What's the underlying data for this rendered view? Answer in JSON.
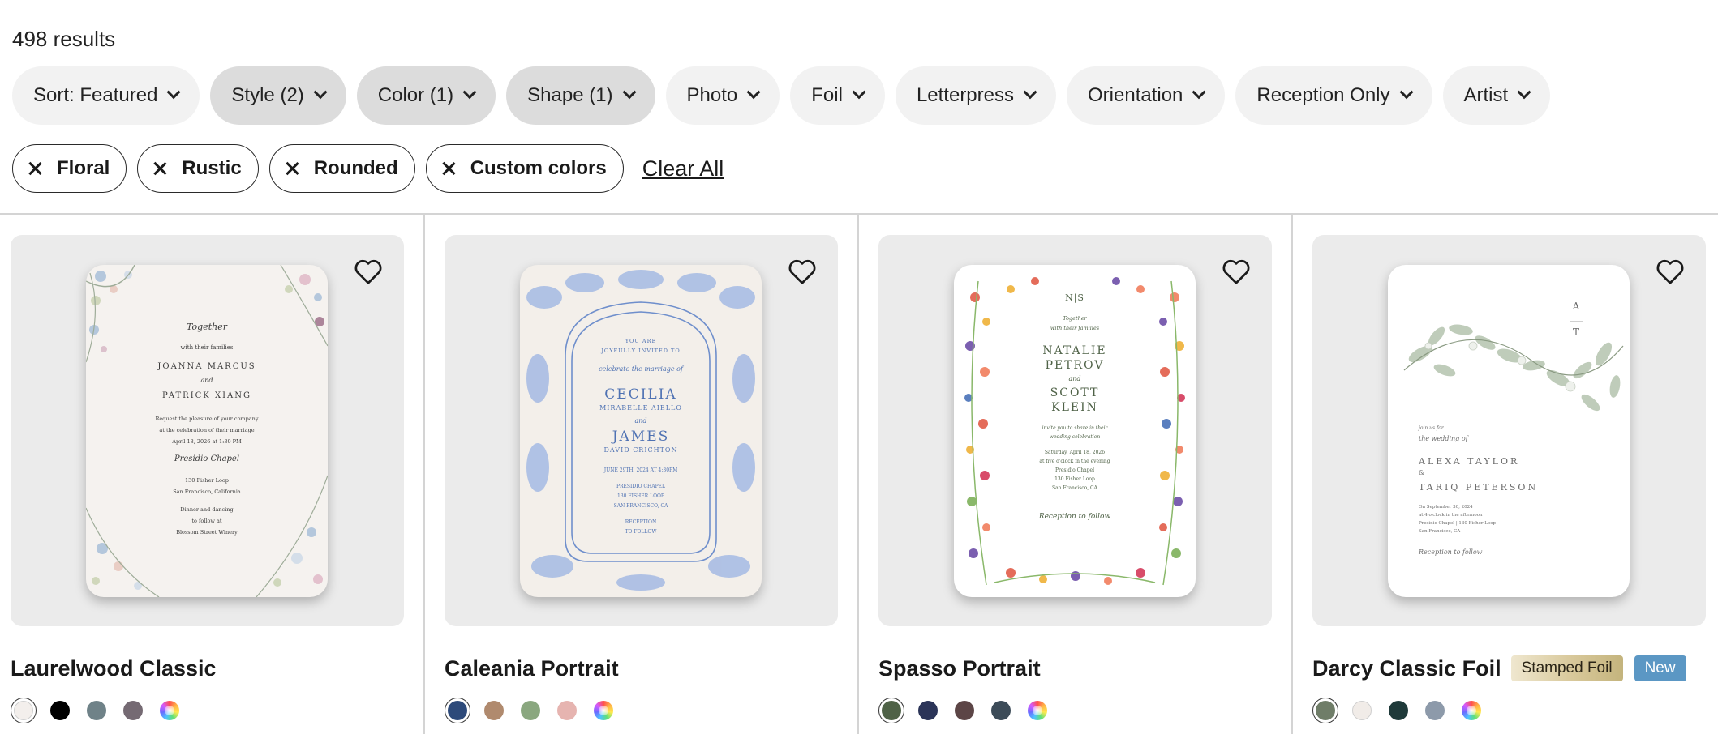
{
  "results_count": "498 results",
  "filters": [
    {
      "label": "Sort: Featured",
      "active": false
    },
    {
      "label": "Style (2)",
      "active": true
    },
    {
      "label": "Color (1)",
      "active": true
    },
    {
      "label": "Shape (1)",
      "active": true
    },
    {
      "label": "Photo",
      "active": false
    },
    {
      "label": "Foil",
      "active": false
    },
    {
      "label": "Letterpress",
      "active": false
    },
    {
      "label": "Orientation",
      "active": false
    },
    {
      "label": "Reception Only",
      "active": false
    },
    {
      "label": "Artist",
      "active": false
    }
  ],
  "applied_chips": [
    "Floral",
    "Rustic",
    "Rounded",
    "Custom colors"
  ],
  "clear_all": "Clear All",
  "products": [
    {
      "title": "Laurelwood Classic",
      "invite": {
        "l1": "Together",
        "l2": "with their families",
        "l3": "JOANNA MARCUS",
        "l4": "and",
        "l5": "PATRICK XIANG",
        "l6": "Request the pleasure of your company",
        "l7": "at the celebration of their marriage",
        "l8": "April 18, 2026 at 1:30 PM",
        "l9": "Presidio Chapel",
        "l10": "130 Fisher Loop",
        "l11": "San Francisco, California",
        "l12": "Dinner and dancing",
        "l13": "to follow at",
        "l14": "Blossom Street Winery"
      },
      "swatches": [
        "#f3efec",
        "#000000",
        "#6f8288",
        "#756a73",
        "multi"
      ]
    },
    {
      "title": "Caleania Portrait",
      "invite": {
        "l1": "YOU ARE",
        "l2": "JOYFULLY INVITED TO",
        "l3": "celebrate the marriage of",
        "l4": "CECILIA",
        "l5": "MIRABELLE AIELLO",
        "l6": "and",
        "l7": "JAMES",
        "l8": "DAVID CRICHTON",
        "l9": "JUNE 29TH, 2024 AT 4:30PM",
        "l10": "PRESIDIO CHAPEL",
        "l11": "130 FISHER LOOP",
        "l12": "SAN FRANCISCO, CA",
        "l13": "RECEPTION",
        "l14": "TO FOLLOW"
      },
      "swatches": [
        "#2d4a7a",
        "#b08a6e",
        "#8aa77f",
        "#e6b4b0",
        "multi"
      ]
    },
    {
      "title": "Spasso Portrait",
      "invite": {
        "l1": "N|S",
        "l2": "Together",
        "l3": "with their families",
        "l4": "NATALIE",
        "l5": "PETROV",
        "l6": "and",
        "l7": "SCOTT",
        "l8": "KLEIN",
        "l9": "invite you to share in their",
        "l10": "wedding celebration",
        "l11": "Saturday, April 18, 2026",
        "l12": "at five o'clock in the evening",
        "l13": "Presidio Chapel",
        "l14": "130 Fisher Loop",
        "l15": "San Francisco, CA",
        "l16": "Reception to follow"
      },
      "swatches": [
        "#4f6247",
        "#2b3458",
        "#5c4546",
        "#3c4b58",
        "multi"
      ]
    },
    {
      "title": "Darcy Classic Foil",
      "badge_foil": "Stamped Foil",
      "badge_new": "New",
      "invite": {
        "l1": "A",
        "l2": "T",
        "l3": "join us for",
        "l4": "the wedding of",
        "l5": "ALEXA TAYLOR",
        "l6": "&",
        "l7": "TARIQ PETERSON",
        "l8": "On September 30, 2024",
        "l9": "at 4 o'clock in the afternoon",
        "l10": "Presidio Chapel | 130 Fisher Loop",
        "l11": "San Francisco, CA",
        "l12": "Reception to follow"
      },
      "swatches": [
        "#6f7d68",
        "#f1ece8",
        "#1f3a3a",
        "#8d9aaa",
        "multi"
      ]
    }
  ],
  "colors": {
    "active_filter_bg": "#dcdcdc",
    "filter_bg": "#f2f2f2",
    "new_badge": "#5b97c4",
    "card_bg": "#ebebeb"
  }
}
